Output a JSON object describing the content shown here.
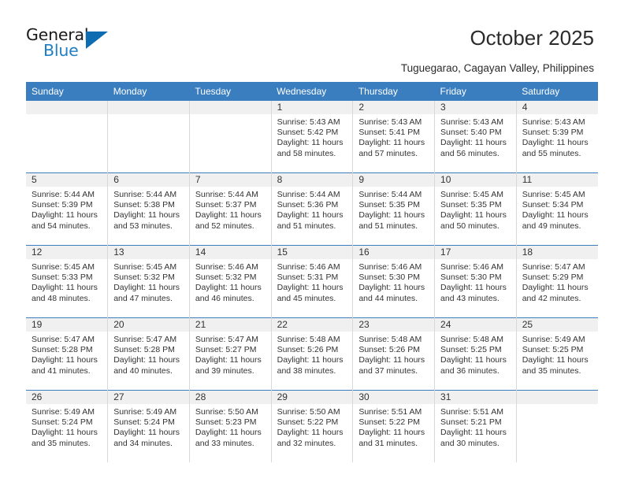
{
  "brand": {
    "name_top": "General",
    "name_bottom": "Blue",
    "accent_color": "#0e6cb0",
    "logo_icon": "triangle-icon"
  },
  "header": {
    "title": "October 2025",
    "subtitle": "Tuguegarao, Cagayan Valley, Philippines"
  },
  "calendar": {
    "header_bg": "#3a7ebf",
    "daynum_bg": "#f0f0f0",
    "weekdays": [
      "Sunday",
      "Monday",
      "Tuesday",
      "Wednesday",
      "Thursday",
      "Friday",
      "Saturday"
    ],
    "weeks": [
      [
        {
          "day": "",
          "lines": []
        },
        {
          "day": "",
          "lines": []
        },
        {
          "day": "",
          "lines": []
        },
        {
          "day": "1",
          "lines": [
            "Sunrise: 5:43 AM",
            "Sunset: 5:42 PM",
            "Daylight: 11 hours",
            "and 58 minutes."
          ]
        },
        {
          "day": "2",
          "lines": [
            "Sunrise: 5:43 AM",
            "Sunset: 5:41 PM",
            "Daylight: 11 hours",
            "and 57 minutes."
          ]
        },
        {
          "day": "3",
          "lines": [
            "Sunrise: 5:43 AM",
            "Sunset: 5:40 PM",
            "Daylight: 11 hours",
            "and 56 minutes."
          ]
        },
        {
          "day": "4",
          "lines": [
            "Sunrise: 5:43 AM",
            "Sunset: 5:39 PM",
            "Daylight: 11 hours",
            "and 55 minutes."
          ]
        }
      ],
      [
        {
          "day": "5",
          "lines": [
            "Sunrise: 5:44 AM",
            "Sunset: 5:39 PM",
            "Daylight: 11 hours",
            "and 54 minutes."
          ]
        },
        {
          "day": "6",
          "lines": [
            "Sunrise: 5:44 AM",
            "Sunset: 5:38 PM",
            "Daylight: 11 hours",
            "and 53 minutes."
          ]
        },
        {
          "day": "7",
          "lines": [
            "Sunrise: 5:44 AM",
            "Sunset: 5:37 PM",
            "Daylight: 11 hours",
            "and 52 minutes."
          ]
        },
        {
          "day": "8",
          "lines": [
            "Sunrise: 5:44 AM",
            "Sunset: 5:36 PM",
            "Daylight: 11 hours",
            "and 51 minutes."
          ]
        },
        {
          "day": "9",
          "lines": [
            "Sunrise: 5:44 AM",
            "Sunset: 5:35 PM",
            "Daylight: 11 hours",
            "and 51 minutes."
          ]
        },
        {
          "day": "10",
          "lines": [
            "Sunrise: 5:45 AM",
            "Sunset: 5:35 PM",
            "Daylight: 11 hours",
            "and 50 minutes."
          ]
        },
        {
          "day": "11",
          "lines": [
            "Sunrise: 5:45 AM",
            "Sunset: 5:34 PM",
            "Daylight: 11 hours",
            "and 49 minutes."
          ]
        }
      ],
      [
        {
          "day": "12",
          "lines": [
            "Sunrise: 5:45 AM",
            "Sunset: 5:33 PM",
            "Daylight: 11 hours",
            "and 48 minutes."
          ]
        },
        {
          "day": "13",
          "lines": [
            "Sunrise: 5:45 AM",
            "Sunset: 5:32 PM",
            "Daylight: 11 hours",
            "and 47 minutes."
          ]
        },
        {
          "day": "14",
          "lines": [
            "Sunrise: 5:46 AM",
            "Sunset: 5:32 PM",
            "Daylight: 11 hours",
            "and 46 minutes."
          ]
        },
        {
          "day": "15",
          "lines": [
            "Sunrise: 5:46 AM",
            "Sunset: 5:31 PM",
            "Daylight: 11 hours",
            "and 45 minutes."
          ]
        },
        {
          "day": "16",
          "lines": [
            "Sunrise: 5:46 AM",
            "Sunset: 5:30 PM",
            "Daylight: 11 hours",
            "and 44 minutes."
          ]
        },
        {
          "day": "17",
          "lines": [
            "Sunrise: 5:46 AM",
            "Sunset: 5:30 PM",
            "Daylight: 11 hours",
            "and 43 minutes."
          ]
        },
        {
          "day": "18",
          "lines": [
            "Sunrise: 5:47 AM",
            "Sunset: 5:29 PM",
            "Daylight: 11 hours",
            "and 42 minutes."
          ]
        }
      ],
      [
        {
          "day": "19",
          "lines": [
            "Sunrise: 5:47 AM",
            "Sunset: 5:28 PM",
            "Daylight: 11 hours",
            "and 41 minutes."
          ]
        },
        {
          "day": "20",
          "lines": [
            "Sunrise: 5:47 AM",
            "Sunset: 5:28 PM",
            "Daylight: 11 hours",
            "and 40 minutes."
          ]
        },
        {
          "day": "21",
          "lines": [
            "Sunrise: 5:47 AM",
            "Sunset: 5:27 PM",
            "Daylight: 11 hours",
            "and 39 minutes."
          ]
        },
        {
          "day": "22",
          "lines": [
            "Sunrise: 5:48 AM",
            "Sunset: 5:26 PM",
            "Daylight: 11 hours",
            "and 38 minutes."
          ]
        },
        {
          "day": "23",
          "lines": [
            "Sunrise: 5:48 AM",
            "Sunset: 5:26 PM",
            "Daylight: 11 hours",
            "and 37 minutes."
          ]
        },
        {
          "day": "24",
          "lines": [
            "Sunrise: 5:48 AM",
            "Sunset: 5:25 PM",
            "Daylight: 11 hours",
            "and 36 minutes."
          ]
        },
        {
          "day": "25",
          "lines": [
            "Sunrise: 5:49 AM",
            "Sunset: 5:25 PM",
            "Daylight: 11 hours",
            "and 35 minutes."
          ]
        }
      ],
      [
        {
          "day": "26",
          "lines": [
            "Sunrise: 5:49 AM",
            "Sunset: 5:24 PM",
            "Daylight: 11 hours",
            "and 35 minutes."
          ]
        },
        {
          "day": "27",
          "lines": [
            "Sunrise: 5:49 AM",
            "Sunset: 5:24 PM",
            "Daylight: 11 hours",
            "and 34 minutes."
          ]
        },
        {
          "day": "28",
          "lines": [
            "Sunrise: 5:50 AM",
            "Sunset: 5:23 PM",
            "Daylight: 11 hours",
            "and 33 minutes."
          ]
        },
        {
          "day": "29",
          "lines": [
            "Sunrise: 5:50 AM",
            "Sunset: 5:22 PM",
            "Daylight: 11 hours",
            "and 32 minutes."
          ]
        },
        {
          "day": "30",
          "lines": [
            "Sunrise: 5:51 AM",
            "Sunset: 5:22 PM",
            "Daylight: 11 hours",
            "and 31 minutes."
          ]
        },
        {
          "day": "31",
          "lines": [
            "Sunrise: 5:51 AM",
            "Sunset: 5:21 PM",
            "Daylight: 11 hours",
            "and 30 minutes."
          ]
        },
        {
          "day": "",
          "lines": []
        }
      ]
    ]
  }
}
